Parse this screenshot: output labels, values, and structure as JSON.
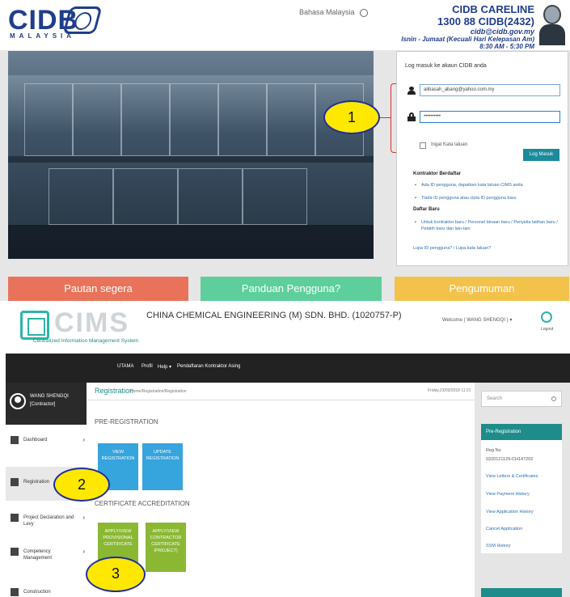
{
  "top": {
    "logo_text": "CIDB",
    "logo_sub": "MALAYSIA",
    "language": "Bahasa Malaysia",
    "careline": {
      "title": "CIDB CARELINE",
      "phone": "1300 88 CIDB(2432)",
      "email": "cidb@cidb.gov.my",
      "days": "Isnin - Jumaat (Kecuali Hari Kelepasan Am)",
      "hours": "8:30 AM - 5:30 PM"
    },
    "login": {
      "title": "Log masuk ke akaun CIDB anda",
      "email_value": "alibasah_abang@yahoo.com.my",
      "password_value": "••••••••••",
      "remember_label": "Ingat Kata laluan",
      "button_label": "Log Masuk",
      "registered_heading": "Kontraktor Berdaftar",
      "registered_items": [
        "Ada ID pengguna, dapatkan kata laluan CIMS anda",
        "Tiada ID pengguna atau cipta ID pengguna baru"
      ],
      "new_heading": "Daftar Baru",
      "new_items": [
        "Untuk kontraktor baru / Personel binaan baru / Penyelia latihan baru / Pelatih baru dan lain-lain"
      ],
      "forgot_link": "Lupa ID pengguna? / Lupa kata laluan?"
    },
    "banners": [
      {
        "label": "Pautan segera",
        "color": "#e8735a"
      },
      {
        "label": "Panduan Pengguna?",
        "color": "#5ecf9c"
      },
      {
        "label": "Pengumuman",
        "color": "#f3c24b"
      }
    ]
  },
  "callouts": [
    "1",
    "2",
    "3"
  ],
  "bottom": {
    "logo_text": "CIMS",
    "logo_sub": "Centralized Information Management System",
    "company": "CHINA CHEMICAL ENGINEERING (M) SDN. BHD. (1020757-P)",
    "welcome": "Welcome ( WANG SHENGQI ) ▾",
    "logout": "Logout",
    "nav": [
      "UTAMA",
      "Profil",
      "Help ▾",
      "Pendaftaran Kontraktor Asing"
    ],
    "user": {
      "name": "WANG SHENGQI",
      "role": "[Contractor]"
    },
    "sidebar": [
      {
        "label": "Dashboard"
      },
      {
        "label": "Registration"
      },
      {
        "label": "Project Declaration and Levy"
      },
      {
        "label": "Competency Management"
      },
      {
        "label": "Construction"
      }
    ],
    "breadcrumb": {
      "title": "Registration",
      "path": "Home/Registration/Registration",
      "date": "Friday,23/03/2018 11:21"
    },
    "pre_registration": {
      "title": "PRE-REGISTRATION",
      "tiles": [
        "VIEW REGISTRATION",
        "UPDATE REGISTRATION"
      ]
    },
    "certificate": {
      "title": "CERTIFICATE ACCREDITATION",
      "tiles": [
        "APPLY/VIEW PROVISIONAL CERTIFICATE",
        "APPLY/VIEW CONTRACTOR CERTIFICATE (PROJECT)"
      ]
    },
    "rightbar": {
      "search_placeholder": "Search",
      "heading": "Pre-Registration",
      "links": [
        "Reg No",
        "0320121129-CH147202",
        "View Letters & Certificates",
        "View Payment History",
        "View Application History",
        "Cancel Application",
        "SSM History"
      ]
    }
  }
}
